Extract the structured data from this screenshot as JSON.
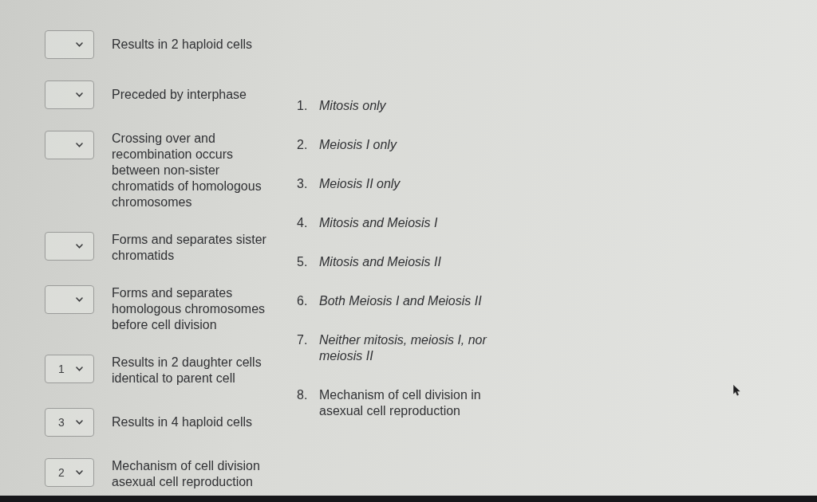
{
  "questions": [
    {
      "prompt": "Results in 2 haploid cells"
    },
    {
      "prompt": "Preceded by interphase"
    },
    {
      "prompt": "Crossing over and recombination occurs between non-sister chromatids of homologous chromosomes"
    },
    {
      "prompt": "Forms and separates sister chromatids"
    },
    {
      "prompt": "Forms and separates homologous chromosomes before cell division"
    },
    {
      "value": "1",
      "prompt": "Results in 2 daughter cells identical to parent cell"
    },
    {
      "value": "3",
      "prompt": "Results in 4 haploid cells"
    },
    {
      "value": "2",
      "prompt": "Mechanism of cell division asexual cell reproduction"
    }
  ],
  "choices": [
    {
      "number": "1.",
      "text": "Mitosis only",
      "italic": true
    },
    {
      "number": "2.",
      "text": "Meiosis I only",
      "italic": true
    },
    {
      "number": "3.",
      "text": "Meiosis II only",
      "italic": true
    },
    {
      "number": "4.",
      "text": "Mitosis and Meiosis I",
      "italic": true
    },
    {
      "number": "5.",
      "text": "Mitosis and Meiosis II",
      "italic": true
    },
    {
      "number": "6.",
      "text": "Both Meiosis I and Meiosis II",
      "italic": true
    },
    {
      "number": "7.",
      "text": "Neither mitosis, meiosis I, nor meiosis II",
      "italic": true
    },
    {
      "number": "8.",
      "text": "Mechanism of cell division in asexual cell reproduction",
      "italic": false
    }
  ]
}
